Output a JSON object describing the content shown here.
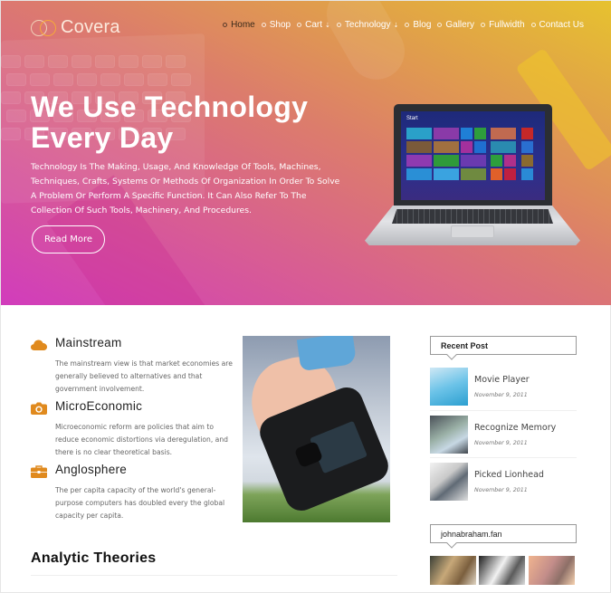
{
  "brand": {
    "name": "Covera",
    "colors": {
      "accent": "#e08a1e",
      "hero_gradient_start": "#d13cbc",
      "hero_gradient_end": "#e6c22f"
    }
  },
  "nav": {
    "items": [
      {
        "label": "Home",
        "active": true,
        "has_dropdown": false
      },
      {
        "label": "Shop",
        "active": false,
        "has_dropdown": false
      },
      {
        "label": "Cart",
        "active": false,
        "has_dropdown": true
      },
      {
        "label": "Technology",
        "active": false,
        "has_dropdown": true
      },
      {
        "label": "Blog",
        "active": false,
        "has_dropdown": false
      },
      {
        "label": "Gallery",
        "active": false,
        "has_dropdown": false
      },
      {
        "label": "Fullwidth",
        "active": false,
        "has_dropdown": false
      },
      {
        "label": "Contact Us",
        "active": false,
        "has_dropdown": false
      }
    ],
    "dropdown_glyph": "⇣"
  },
  "hero": {
    "title_line1": "We Use Technology",
    "title_line2": "Every Day",
    "text": "Technology Is The Making, Usage, And Knowledge Of Tools, Machines, Techniques, Crafts, Systems Or Methods Of Organization In Order To Solve A Problem Or Perform A Specific Function. It Can Also Refer To The Collection Of Such Tools, Machinery, And Procedures.",
    "button_label": "Read More",
    "laptop_screen_label": "Start"
  },
  "features": [
    {
      "icon": "cloud-icon",
      "title": "Mainstream",
      "text": "The mainstream view is that market economies are generally believed to alternatives and that government involvement."
    },
    {
      "icon": "camera-icon",
      "title": "MicroEconomic",
      "text": "Microeconomic reform are policies that aim to reduce economic distortions via deregulation, and there is no clear theoretical basis."
    },
    {
      "icon": "briefcase-icon",
      "title": "Anglosphere",
      "text": "The per capita capacity of the world's general-purpose computers has doubled every the global capacity per capita."
    }
  ],
  "section": {
    "title": "Analytic Theories"
  },
  "sidebar": {
    "recent_post_heading": "Recent Post",
    "posts": [
      {
        "title": "Movie Player",
        "date": "November 9, 2011"
      },
      {
        "title": "Recognize Memory",
        "date": "November 9, 2011"
      },
      {
        "title": "Picked Lionhead",
        "date": "November 9, 2011"
      }
    ],
    "instagram_heading": "johnabraham.fan",
    "instagram_count": 3
  }
}
